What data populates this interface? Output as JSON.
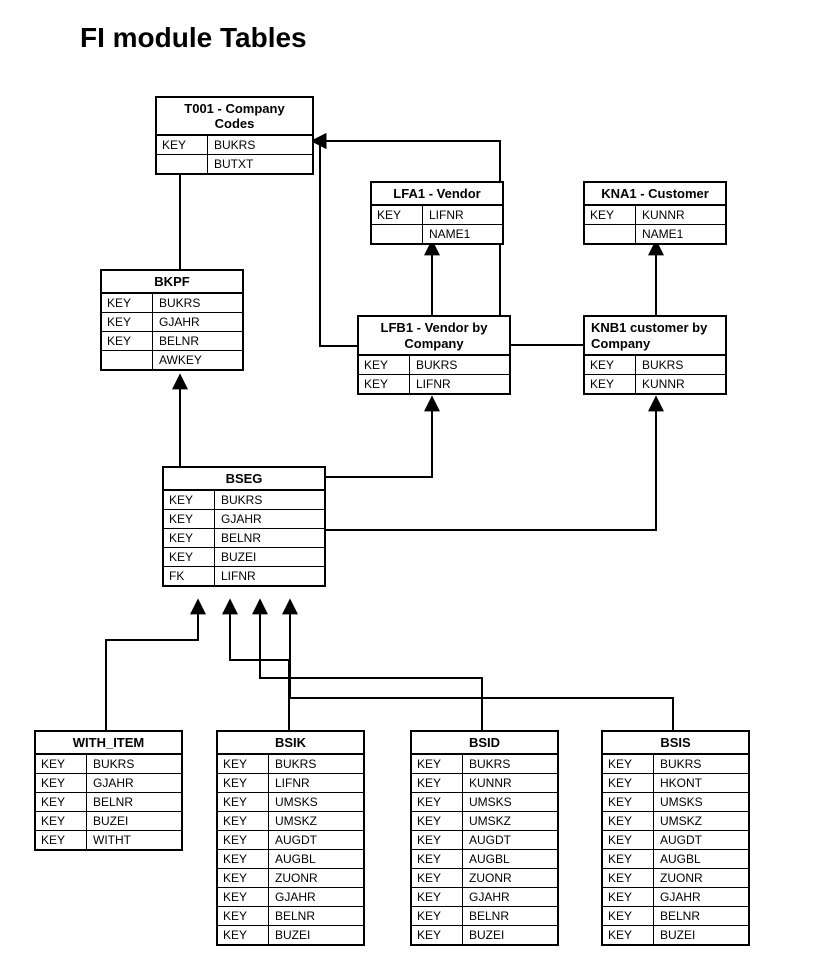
{
  "title": "FI module Tables",
  "tables": {
    "t001": {
      "name": "T001 - Company Codes",
      "rows": [
        {
          "k": "KEY",
          "v": "BUKRS"
        },
        {
          "k": "",
          "v": "BUTXT"
        }
      ]
    },
    "lfa1": {
      "name": "LFA1 - Vendor",
      "rows": [
        {
          "k": "KEY",
          "v": "LIFNR"
        },
        {
          "k": "",
          "v": "NAME1"
        }
      ]
    },
    "kna1": {
      "name": "KNA1 - Customer",
      "rows": [
        {
          "k": "KEY",
          "v": "KUNNR"
        },
        {
          "k": "",
          "v": "NAME1"
        }
      ]
    },
    "bkpf": {
      "name": "BKPF",
      "rows": [
        {
          "k": "KEY",
          "v": "BUKRS"
        },
        {
          "k": "KEY",
          "v": "GJAHR"
        },
        {
          "k": "KEY",
          "v": "BELNR"
        },
        {
          "k": "",
          "v": "AWKEY"
        }
      ]
    },
    "lfb1": {
      "name": "LFB1 - Vendor by Company",
      "rows": [
        {
          "k": "KEY",
          "v": "BUKRS"
        },
        {
          "k": "KEY",
          "v": "LIFNR"
        }
      ]
    },
    "knb1": {
      "name": "KNB1 customer by Company",
      "rows": [
        {
          "k": "KEY",
          "v": "BUKRS"
        },
        {
          "k": "KEY",
          "v": "KUNNR"
        }
      ]
    },
    "bseg": {
      "name": "BSEG",
      "rows": [
        {
          "k": "KEY",
          "v": "BUKRS"
        },
        {
          "k": "KEY",
          "v": "GJAHR"
        },
        {
          "k": "KEY",
          "v": "BELNR"
        },
        {
          "k": "KEY",
          "v": "BUZEI"
        },
        {
          "k": "FK",
          "v": "LIFNR"
        }
      ]
    },
    "with_item": {
      "name": "WITH_ITEM",
      "rows": [
        {
          "k": "KEY",
          "v": "BUKRS"
        },
        {
          "k": "KEY",
          "v": "GJAHR"
        },
        {
          "k": "KEY",
          "v": "BELNR"
        },
        {
          "k": "KEY",
          "v": "BUZEI"
        },
        {
          "k": "KEY",
          "v": "WITHT"
        }
      ]
    },
    "bsik": {
      "name": "BSIK",
      "rows": [
        {
          "k": "KEY",
          "v": "BUKRS"
        },
        {
          "k": "KEY",
          "v": "LIFNR"
        },
        {
          "k": "KEY",
          "v": "UMSKS"
        },
        {
          "k": "KEY",
          "v": "UMSKZ"
        },
        {
          "k": "KEY",
          "v": "AUGDT"
        },
        {
          "k": "KEY",
          "v": "AUGBL"
        },
        {
          "k": "KEY",
          "v": "ZUONR"
        },
        {
          "k": "KEY",
          "v": "GJAHR"
        },
        {
          "k": "KEY",
          "v": "BELNR"
        },
        {
          "k": "KEY",
          "v": "BUZEI"
        }
      ]
    },
    "bsid": {
      "name": "BSID",
      "rows": [
        {
          "k": "KEY",
          "v": "BUKRS"
        },
        {
          "k": "KEY",
          "v": "KUNNR"
        },
        {
          "k": "KEY",
          "v": "UMSKS"
        },
        {
          "k": "KEY",
          "v": "UMSKZ"
        },
        {
          "k": "KEY",
          "v": "AUGDT"
        },
        {
          "k": "KEY",
          "v": "AUGBL"
        },
        {
          "k": "KEY",
          "v": "ZUONR"
        },
        {
          "k": "KEY",
          "v": "GJAHR"
        },
        {
          "k": "KEY",
          "v": "BELNR"
        },
        {
          "k": "KEY",
          "v": "BUZEI"
        }
      ]
    },
    "bsis": {
      "name": "BSIS",
      "rows": [
        {
          "k": "KEY",
          "v": "BUKRS"
        },
        {
          "k": "KEY",
          "v": "HKONT"
        },
        {
          "k": "KEY",
          "v": "UMSKS"
        },
        {
          "k": "KEY",
          "v": "UMSKZ"
        },
        {
          "k": "KEY",
          "v": "AUGDT"
        },
        {
          "k": "KEY",
          "v": "AUGBL"
        },
        {
          "k": "KEY",
          "v": "ZUONR"
        },
        {
          "k": "KEY",
          "v": "GJAHR"
        },
        {
          "k": "KEY",
          "v": "BELNR"
        },
        {
          "k": "KEY",
          "v": "BUZEI"
        }
      ]
    }
  }
}
